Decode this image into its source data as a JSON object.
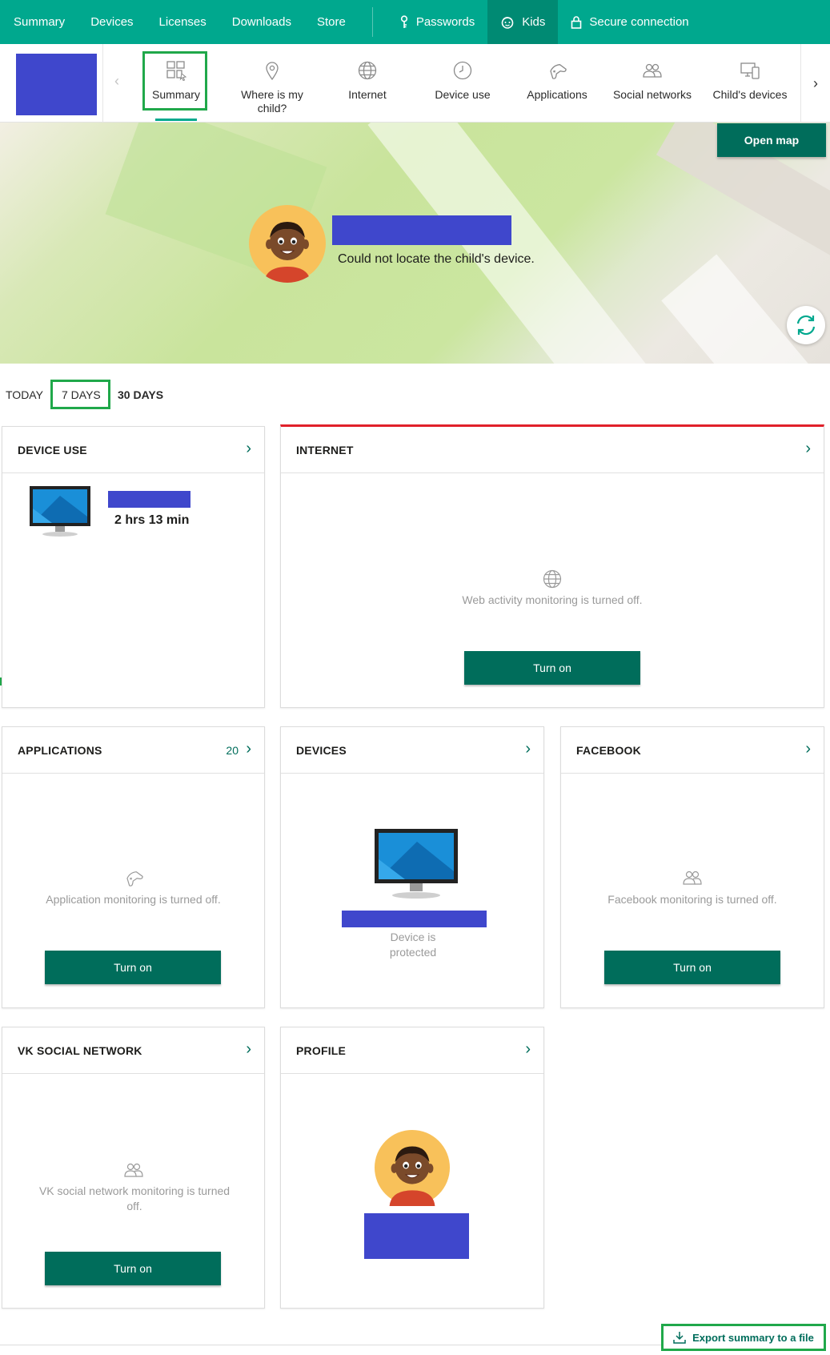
{
  "top_nav": {
    "items": [
      "Summary",
      "Devices",
      "Licenses",
      "Downloads",
      "Store"
    ],
    "passwords": "Passwords",
    "kids": "Kids",
    "secure_connection": "Secure connection"
  },
  "sub_tabs": [
    {
      "label": "Summary",
      "icon": "summary-icon"
    },
    {
      "label": "Where is my child?",
      "icon": "location-pin-icon"
    },
    {
      "label": "Internet",
      "icon": "globe-icon"
    },
    {
      "label": "Device use",
      "icon": "clock-icon"
    },
    {
      "label": "Applications",
      "icon": "gamepad-icon"
    },
    {
      "label": "Social networks",
      "icon": "people-icon"
    },
    {
      "label": "Child's devices",
      "icon": "devices-icon"
    }
  ],
  "map": {
    "open_map": "Open map",
    "locate_message": "Could not locate the child's device."
  },
  "periods": {
    "today": "TODAY",
    "seven_days": "7 DAYS",
    "thirty_days": "30 DAYS"
  },
  "cards": {
    "device_use": {
      "title": "DEVICE USE",
      "duration": "2 hrs 13 min"
    },
    "internet": {
      "title": "INTERNET",
      "message": "Web activity monitoring is turned off.",
      "button": "Turn on"
    },
    "applications": {
      "title": "APPLICATIONS",
      "count": "20",
      "message": "Application monitoring is turned off.",
      "button": "Turn on"
    },
    "devices": {
      "title": "DEVICES",
      "status": "Device is protected"
    },
    "facebook": {
      "title": "FACEBOOK",
      "message": "Facebook monitoring is turned off.",
      "button": "Turn on"
    },
    "vk": {
      "title": "VK SOCIAL NETWORK",
      "message": "VK social network monitoring is turned off.",
      "button": "Turn on"
    },
    "profile": {
      "title": "PROFILE"
    }
  },
  "export": {
    "label": "Export summary to a file"
  },
  "colors": {
    "brand": "#00a88e",
    "dark_green": "#006d5b",
    "redacted": "#3f47cc",
    "highlight": "#20a84a",
    "alert": "#e0202a"
  }
}
